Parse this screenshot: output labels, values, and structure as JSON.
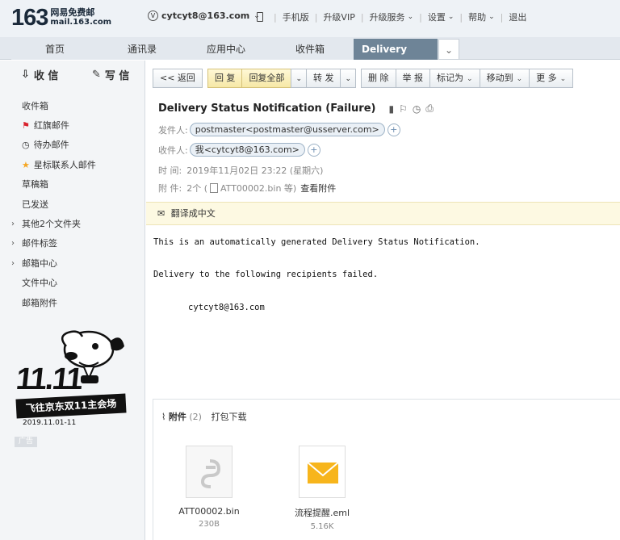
{
  "header": {
    "logo_number": "163",
    "logo_title": "网易免费邮",
    "logo_domain": "mail.163.com",
    "account": "cytcyt8@163.com",
    "nav": [
      "手机版",
      "升级VIP",
      "升级服务",
      "设置",
      "帮助",
      "退出"
    ]
  },
  "tabs": {
    "items": [
      "首页",
      "通讯录",
      "应用中心",
      "收件箱"
    ],
    "active": "Delivery St...",
    "close": "×",
    "more": "⌄"
  },
  "sidebar": {
    "receive": "收 信",
    "compose": "写 信",
    "items": [
      {
        "label": "收件箱"
      },
      {
        "label": "红旗邮件"
      },
      {
        "label": "待办邮件"
      },
      {
        "label": "星标联系人邮件"
      },
      {
        "label": "草稿箱"
      },
      {
        "label": "已发送"
      },
      {
        "label": "其他2个文件夹"
      },
      {
        "label": "邮件标签"
      },
      {
        "label": "邮箱中心"
      },
      {
        "label": "文件中心"
      },
      {
        "label": "邮箱附件"
      }
    ],
    "promo_big": "11.11",
    "promo_text": "飞往京东双11主会场",
    "promo_date": "2019.11.01-11",
    "ad_label": "广告"
  },
  "toolbar": {
    "back": "<< 返回",
    "reply": "回 复",
    "reply_all": "回复全部",
    "forward": "转 发",
    "delete": "删 除",
    "report": "举 报",
    "mark_as": "标记为",
    "move_to": "移动到",
    "more": "更 多"
  },
  "email": {
    "subject": "Delivery Status Notification (Failure)",
    "from_label": "发件人:",
    "from_value": "postmaster<postmaster@usserver.com>",
    "to_label": "收件人:",
    "to_value": "我<cytcyt8@163.com>",
    "time_label": "时 间:",
    "time_value": "2019年11月02日 23:22 (星期六)",
    "attach_label": "附 件:",
    "attach_value_pre": "2个 (",
    "attach_value_file": "ATT00002.bin 等)",
    "attach_view": "查看附件",
    "translate": "翻译成中文",
    "body_lines": [
      "This is an automatically generated Delivery Status Notification.",
      "Delivery to the following recipients failed.",
      "cytcyt8@163.com"
    ]
  },
  "attachments": {
    "title": "附件",
    "count": "(2)",
    "download_all": "打包下载",
    "files": [
      {
        "name": "ATT00002.bin",
        "size": "230B"
      },
      {
        "name": "流程提醒.eml",
        "size": "5.16K"
      }
    ]
  },
  "colors": {
    "active_tab": "#6e8497",
    "flag_red": "#d9232e",
    "star_yellow": "#f5a623",
    "mail_icon": "#f7b51c"
  }
}
